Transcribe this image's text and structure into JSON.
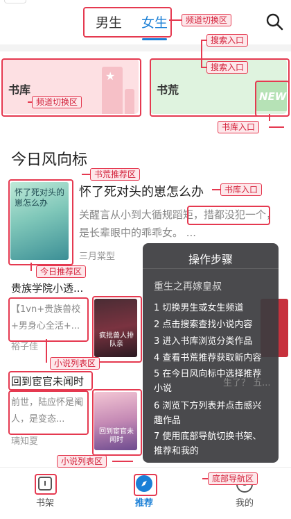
{
  "header": {
    "tab_male": "男生",
    "tab_female": "女生",
    "search_icon": "search-icon"
  },
  "cards": {
    "library_title": "书库",
    "browse_title": "书荒",
    "browse_badge": "NEW"
  },
  "section": {
    "title": "今日风向标"
  },
  "featured": {
    "title": "怀了死对头的崽怎么办",
    "desc": "关醒言从小到大循规蹈矩，措都没犯一个，是长辈眼中的乖乖女。 ...",
    "author": "三月棠型",
    "cover_text": "怀了死对头的崽怎么办"
  },
  "list": [
    {
      "title": "贵族学院小透...",
      "desc": "【1vn+贵族兽校+男身心全活+...",
      "author": "裕子佳",
      "cover_text": "疯批兽人排队亲"
    },
    {
      "title": "回到宦官未闻时",
      "desc": "前世，陆应怀是阉人，是变态...",
      "author": "璃知夏",
      "cover_text": "回到宦官未闻时"
    }
  ],
  "popup": {
    "title": "操作步骤",
    "subtitle": "重生之再嫁皇叔",
    "steps": [
      "1 切换男生或女生频道",
      "2 点击搜索查找小说内容",
      "3 进入书库浏览分类作品",
      "4 查看书荒推荐获取新内容",
      "5 在今日风向标中选择推荐小说",
      "6 浏览下方列表并点击感兴趣作品",
      "7 使用底部导航切换书架、推荐和我的"
    ],
    "behind_fragment": "...",
    "behind_fragment2": "生了？ 五..."
  },
  "bottom_nav": {
    "shelf": "书架",
    "recommend": "推荐",
    "mine": "我的"
  },
  "annotations": {
    "channel_switch": "频道切换区",
    "search_entry_1": "搜索入口",
    "search_entry_2": "搜索入口",
    "channel_switch_2": "频道切换区",
    "library_entry_1": "书库入口",
    "browse_reco": "书荒推荐区",
    "library_entry_2": "书库入口",
    "today_reco": "今日推荐区",
    "novel_list_1": "小说列表区",
    "novel_list_2": "小说列表区",
    "bottom_nav": "底部导航区"
  },
  "colors": {
    "accent": "#1a7fd6",
    "annotation": "#e53950",
    "library_card": "#fde0e3",
    "browse_card": "#dff3df"
  }
}
